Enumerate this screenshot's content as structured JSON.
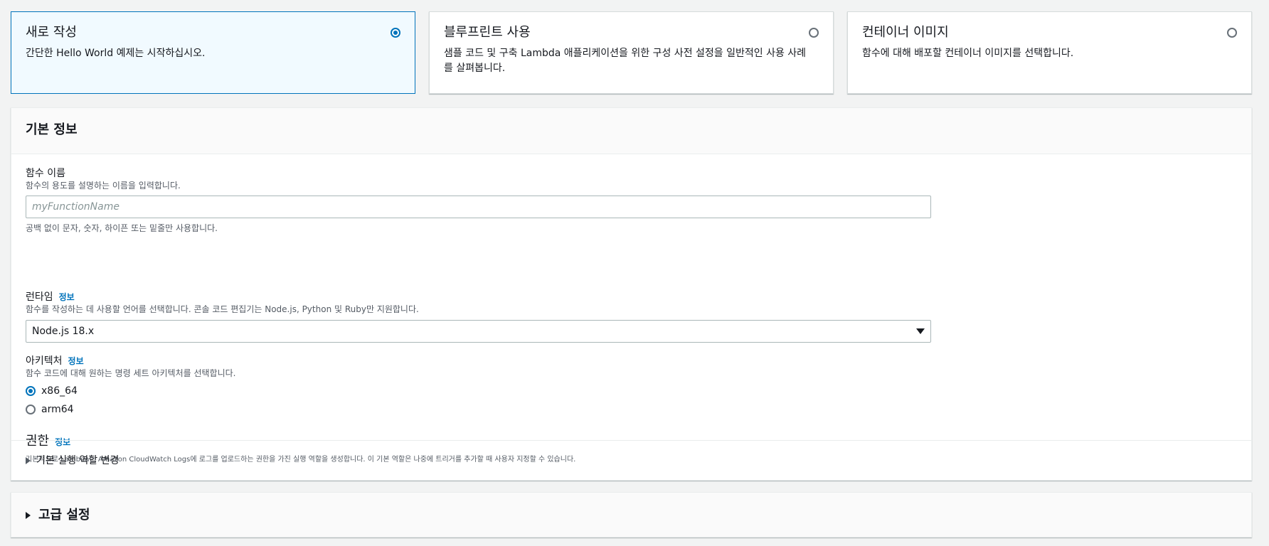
{
  "creation_options": [
    {
      "title": "새로 작성",
      "description": "간단한 Hello World 예제는 시작하십시오.",
      "selected": true
    },
    {
      "title": "블루프린트 사용",
      "description": "샘플 코드 및 구축 Lambda 애플리케이션을 위한 구성 사전 설정을 일반적인 사용 사례를 살펴봅니다.",
      "selected": false
    },
    {
      "title": "컨테이너 이미지",
      "description": "함수에 대해 배포할 컨테이너 이미지를 선택합니다.",
      "selected": false
    }
  ],
  "basic_info": {
    "header": "기본 정보",
    "function_name": {
      "label": "함수 이름",
      "description": "함수의 용도를 설명하는 이름을 입력합니다.",
      "placeholder": "myFunctionName",
      "value": "",
      "constraint": "공백 없이 문자, 숫자, 하이픈 또는 밑줄만 사용합니다."
    },
    "runtime": {
      "label": "런타임",
      "info_link": "정보",
      "description": "함수를 작성하는 데 사용할 언어를 선택합니다. 콘솔 코드 편집기는 Node.js, Python 및 Ruby만 지원합니다.",
      "selected": "Node.js 18.x"
    },
    "architecture": {
      "label": "아키텍처",
      "info_link": "정보",
      "description": "함수 코드에 대해 원하는 명령 세트 아키텍처를 선택합니다.",
      "options": [
        {
          "label": "x86_64",
          "checked": true
        },
        {
          "label": "arm64",
          "checked": false
        }
      ]
    },
    "permissions": {
      "title": "권한",
      "info_link": "정보",
      "description": "기본적으로 Lambda는 Amazon CloudWatch Logs에 로그를 업로드하는 권한을 가진 실행 역할을 생성합니다. 이 기본 역할은 나중에 트리거를 추가할 때 사용자 지정할 수 있습니다."
    },
    "change_role_expander": "기본 실행 역할 변경"
  },
  "advanced_settings": {
    "label": "고급 설정"
  },
  "colors": {
    "accent": "#0073bb",
    "selected_tile_bg": "#f1faff",
    "page_bg": "#f2f3f3"
  }
}
